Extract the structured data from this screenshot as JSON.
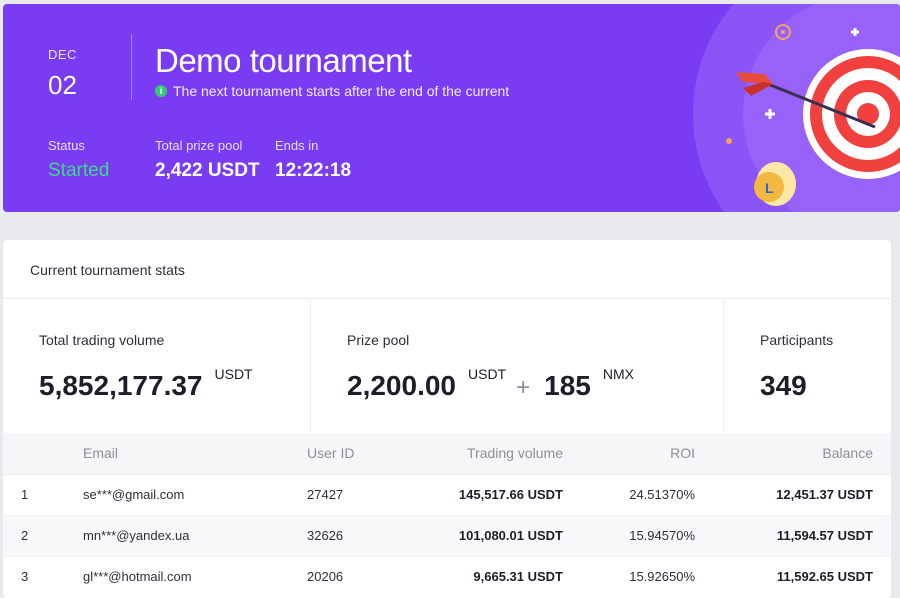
{
  "banner": {
    "month": "DEC",
    "day": "02",
    "title": "Demo tournament",
    "subtitle": "The next tournament starts after the end of the current",
    "status_label": "Status",
    "status_value": "Started",
    "prize_label": "Total prize pool",
    "prize_value": "2,422 USDT",
    "ends_label": "Ends in",
    "ends_value": "12:22:18",
    "colors": {
      "background": "#7a3cf2",
      "status": "#3fd88b"
    }
  },
  "stats": {
    "heading": "Current tournament stats",
    "volume_label": "Total trading volume",
    "volume_value": "5,852,177.37",
    "volume_unit": "USDT",
    "prize_label": "Prize pool",
    "prize_value1": "2,200.00",
    "prize_unit1": "USDT",
    "prize_plus": "+",
    "prize_value2": "185",
    "prize_unit2": "NMX",
    "participants_label": "Participants",
    "participants_value": "349"
  },
  "table": {
    "headers": {
      "email": "Email",
      "user_id": "User ID",
      "volume": "Trading volume",
      "roi": "ROI",
      "balance": "Balance"
    },
    "rows": [
      {
        "rank": "1",
        "email": "se***@gmail.com",
        "user_id": "27427",
        "volume": "145,517.66 USDT",
        "roi": "24.51370%",
        "balance": "12,451.37 USDT"
      },
      {
        "rank": "2",
        "email": "mn***@yandex.ua",
        "user_id": "32626",
        "volume": "101,080.01 USDT",
        "roi": "15.94570%",
        "balance": "11,594.57 USDT"
      },
      {
        "rank": "3",
        "email": "gl***@hotmail.com",
        "user_id": "20206",
        "volume": "9,665.31 USDT",
        "roi": "15.92650%",
        "balance": "11,592.65 USDT"
      }
    ]
  },
  "icons": {
    "info": "info-icon",
    "illustration": "target-dart-illustration"
  }
}
